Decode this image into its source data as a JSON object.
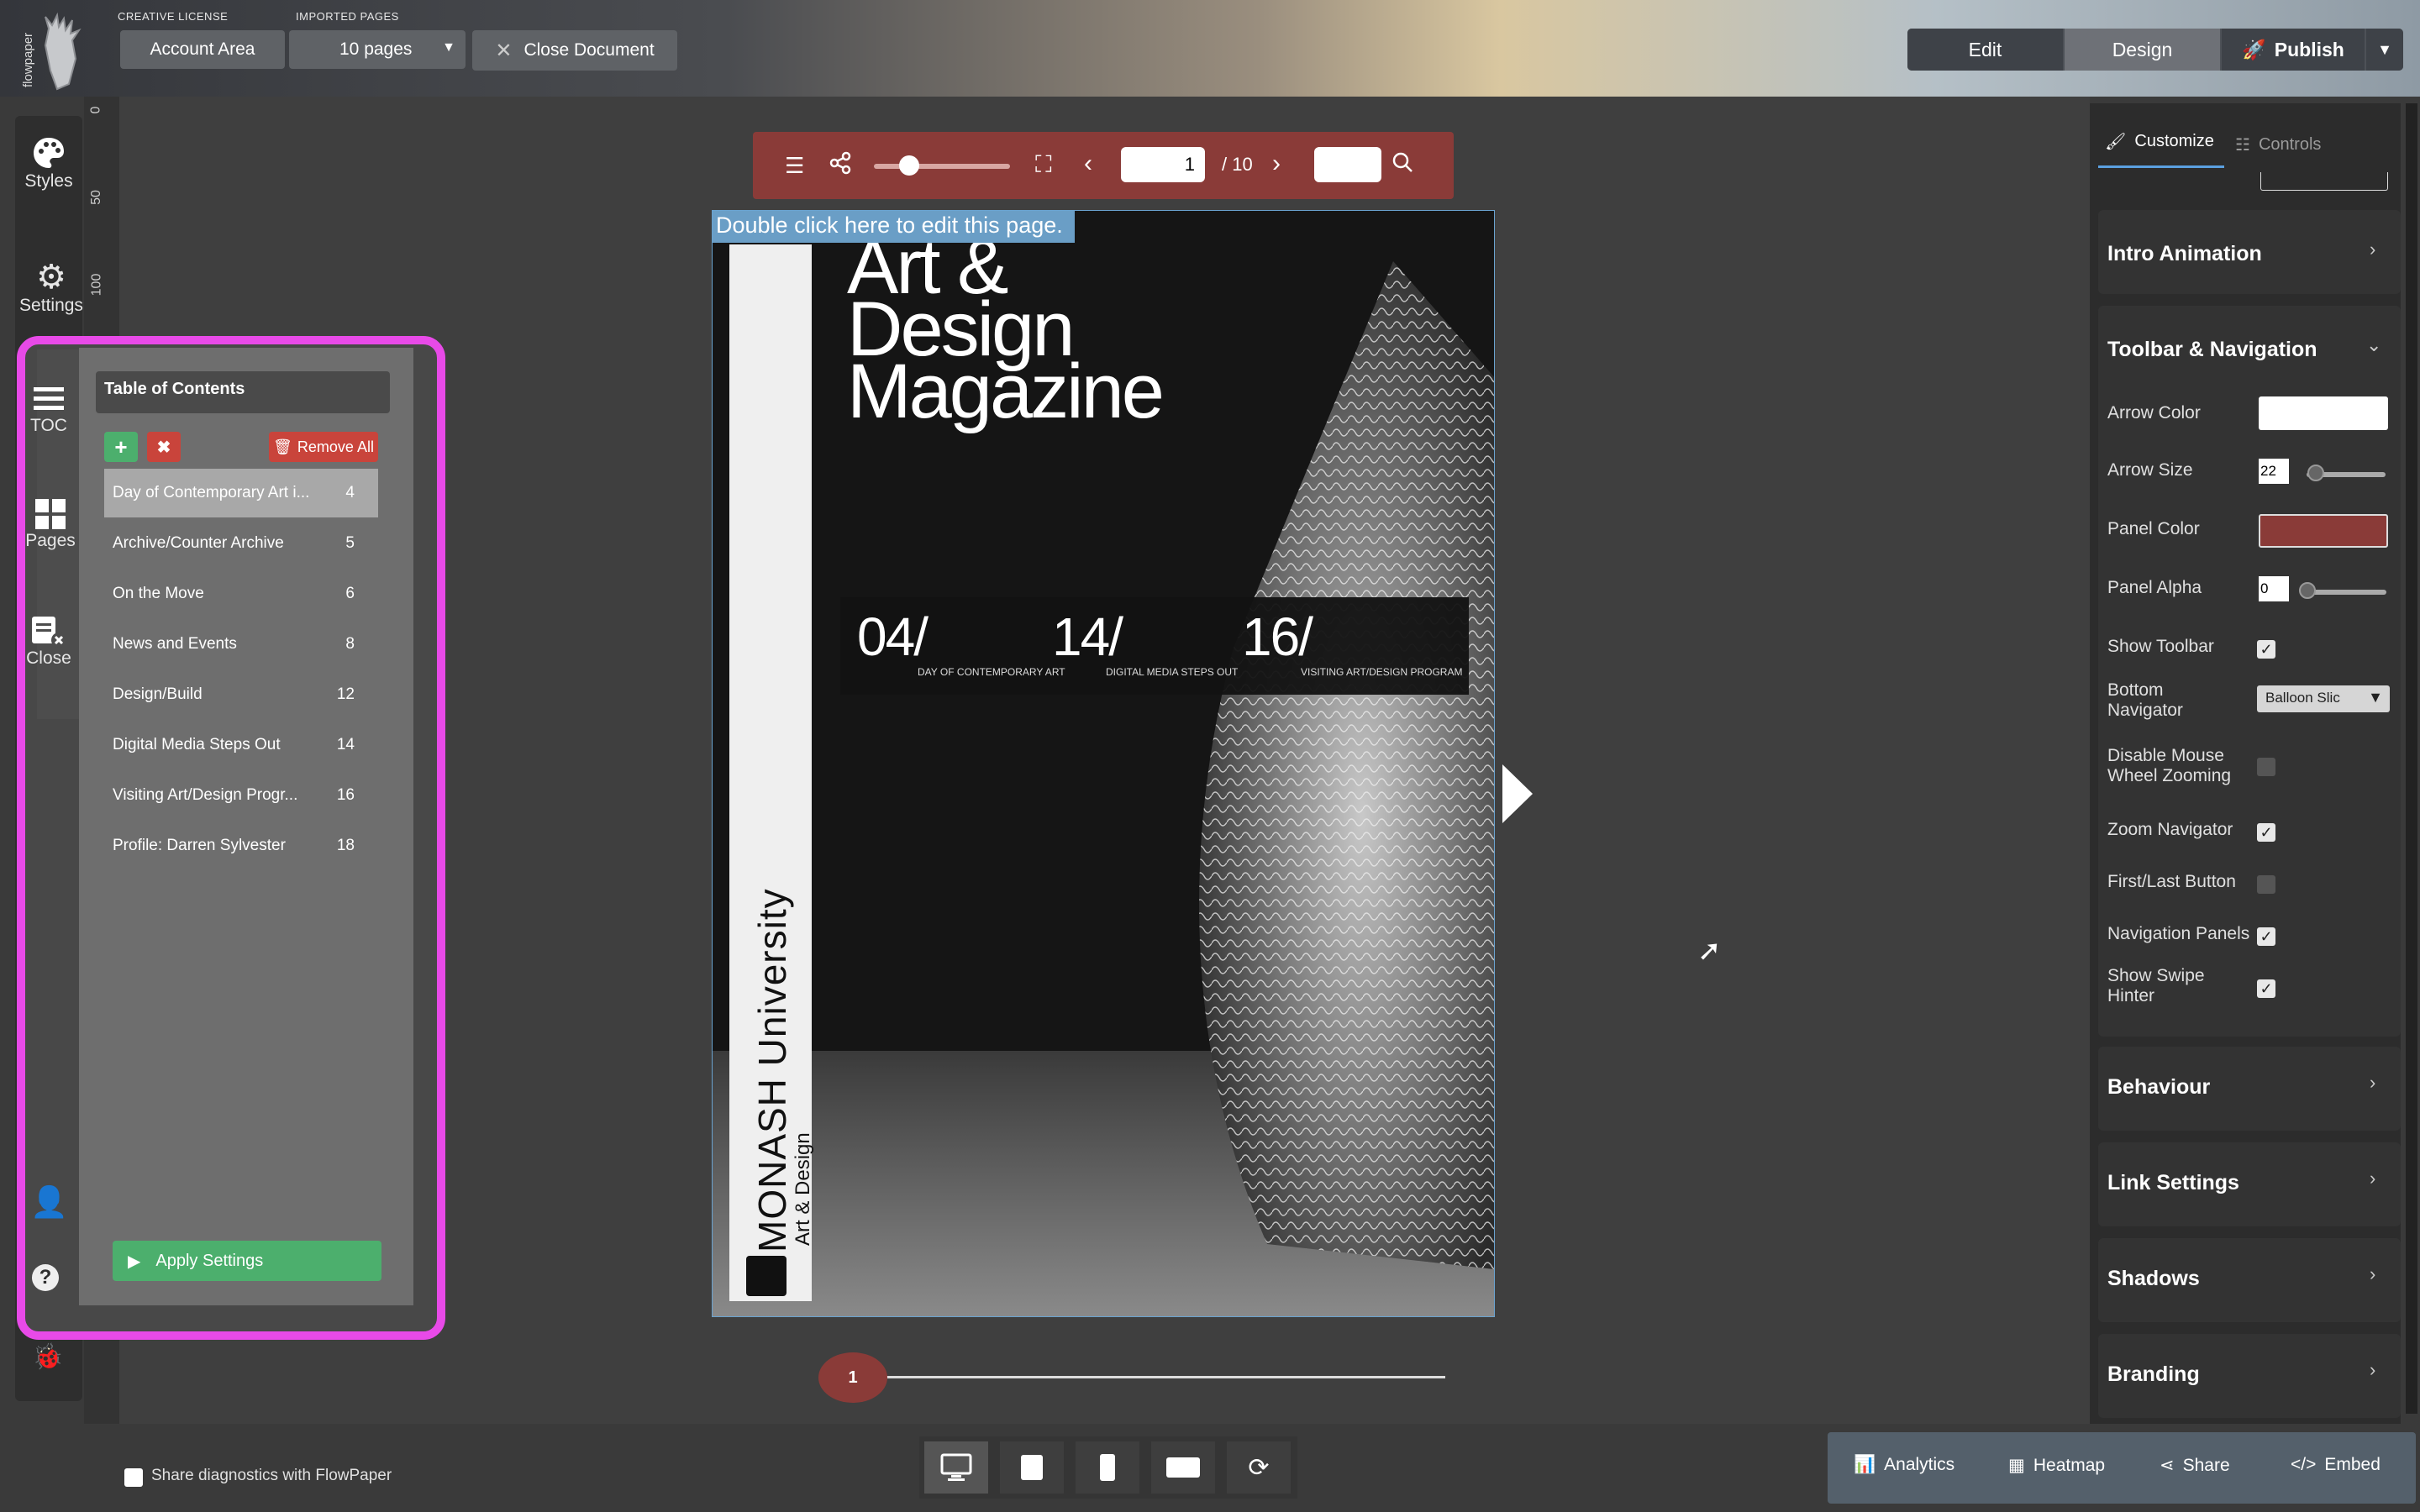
{
  "brand": {
    "logo_text": "flowpaper"
  },
  "topbar": {
    "creative_license_label": "CREATIVE LICENSE",
    "imported_pages_label": "IMPORTED PAGES",
    "account_area": "Account Area",
    "pages_select": "10 pages",
    "close_document": "Close Document",
    "edit": "Edit",
    "design": "Design",
    "publish": "Publish"
  },
  "rail": {
    "styles": "Styles",
    "settings": "Settings",
    "toc": "TOC",
    "pages": "Pages",
    "close": "Close"
  },
  "ruler": {
    "ticks": [
      "0",
      "50",
      "100"
    ]
  },
  "toc": {
    "title": "Table of Contents",
    "remove_all": "Remove All",
    "apply": "Apply Settings",
    "items": [
      {
        "label": "Day of Contemporary Art i...",
        "page": "4"
      },
      {
        "label": "Archive/Counter Archive",
        "page": "5"
      },
      {
        "label": "On the Move",
        "page": "6"
      },
      {
        "label": "News and Events",
        "page": "8"
      },
      {
        "label": "Design/Build",
        "page": "12"
      },
      {
        "label": "Digital Media Steps Out",
        "page": "14"
      },
      {
        "label": "Visiting Art/Design Progr...",
        "page": "16"
      },
      {
        "label": "Profile: Darren Sylvester",
        "page": "18"
      }
    ]
  },
  "viewer": {
    "page_input": "1",
    "page_total": "/ 10",
    "edit_hint": "Double click here to edit this page.",
    "bottom_page": "1"
  },
  "cover": {
    "title_lines": [
      "Art &",
      "Design",
      "Magazine"
    ],
    "features": [
      {
        "num": "04/",
        "caption": "DAY OF CONTEMPORARY ART"
      },
      {
        "num": "14/",
        "caption": "DIGITAL MEDIA STEPS OUT"
      },
      {
        "num": "16/",
        "caption": "VISITING ART/DESIGN PROGRAM"
      }
    ],
    "spine_main": "MONASH University",
    "spine_sub": "Art & Design"
  },
  "right": {
    "tabs": {
      "customize": "Customize",
      "controls": "Controls"
    },
    "intro_animation": "Intro Animation",
    "toolbar_nav": "Toolbar & Navigation",
    "arrow_color": "Arrow Color",
    "arrow_size": "Arrow Size",
    "arrow_size_val": "22",
    "panel_color": "Panel Color",
    "panel_color_hex": "#8a3b38",
    "panel_alpha": "Panel Alpha",
    "panel_alpha_val": "0",
    "show_toolbar": "Show Toolbar",
    "bottom_navigator": "Bottom Navigator",
    "bottom_navigator_val": "Balloon Slic",
    "disable_mouse_wheel": "Disable Mouse Wheel Zooming",
    "zoom_navigator": "Zoom Navigator",
    "first_last": "First/Last Button",
    "nav_panels": "Navigation Panels",
    "swipe_hinter": "Show Swipe Hinter",
    "behaviour": "Behaviour",
    "link_settings": "Link Settings",
    "shadows": "Shadows",
    "branding": "Branding"
  },
  "bottom": {
    "diagnostics": "Share diagnostics with FlowPaper",
    "analytics": "Analytics",
    "heatmap": "Heatmap",
    "share": "Share",
    "embed": "Embed"
  }
}
